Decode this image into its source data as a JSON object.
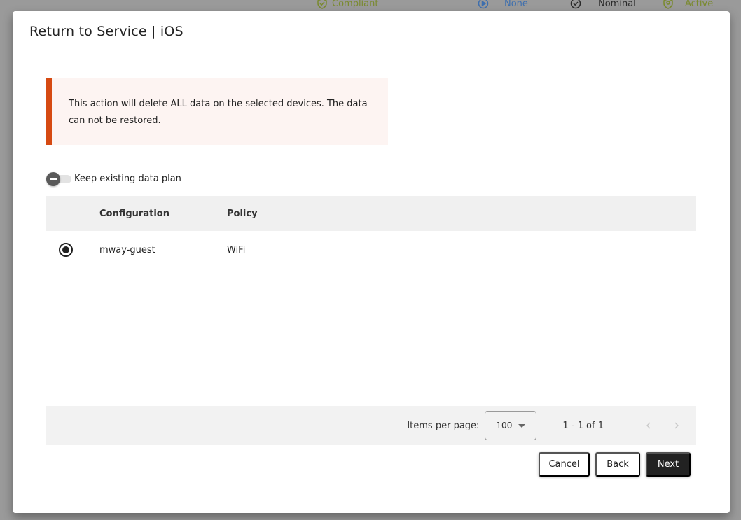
{
  "background": {
    "status_items": [
      {
        "label": "Compliant",
        "icon": "shield-check-icon",
        "color": "#7a8a2e"
      },
      {
        "label": "None",
        "icon": "play-circle-icon",
        "color": "#3e6fae"
      },
      {
        "label": "Nominal",
        "icon": "check-circle-icon",
        "color": "#2a2a2a"
      },
      {
        "label": "Active",
        "icon": "shield-user-icon",
        "color": "#7a8a2e"
      }
    ]
  },
  "dialog": {
    "title": "Return to Service | iOS",
    "warning": {
      "text": "This action will delete ALL data on the selected devices. The data can not be restored.",
      "accent_color": "#d64a12"
    },
    "toggle": {
      "label": "Keep existing data plan",
      "checked": false
    },
    "table": {
      "columns": [
        "",
        "Configuration",
        "Policy"
      ],
      "rows": [
        {
          "selected": true,
          "configuration": "mway-guest",
          "policy": "WiFi"
        }
      ]
    },
    "paginator": {
      "items_per_page_label": "Items per page:",
      "items_per_page_value": "100",
      "range_label": "1 - 1 of 1",
      "prev_icon": "chevron-left-icon",
      "next_icon": "chevron-right-icon"
    },
    "actions": {
      "cancel_label": "Cancel",
      "back_label": "Back",
      "next_label": "Next"
    }
  }
}
